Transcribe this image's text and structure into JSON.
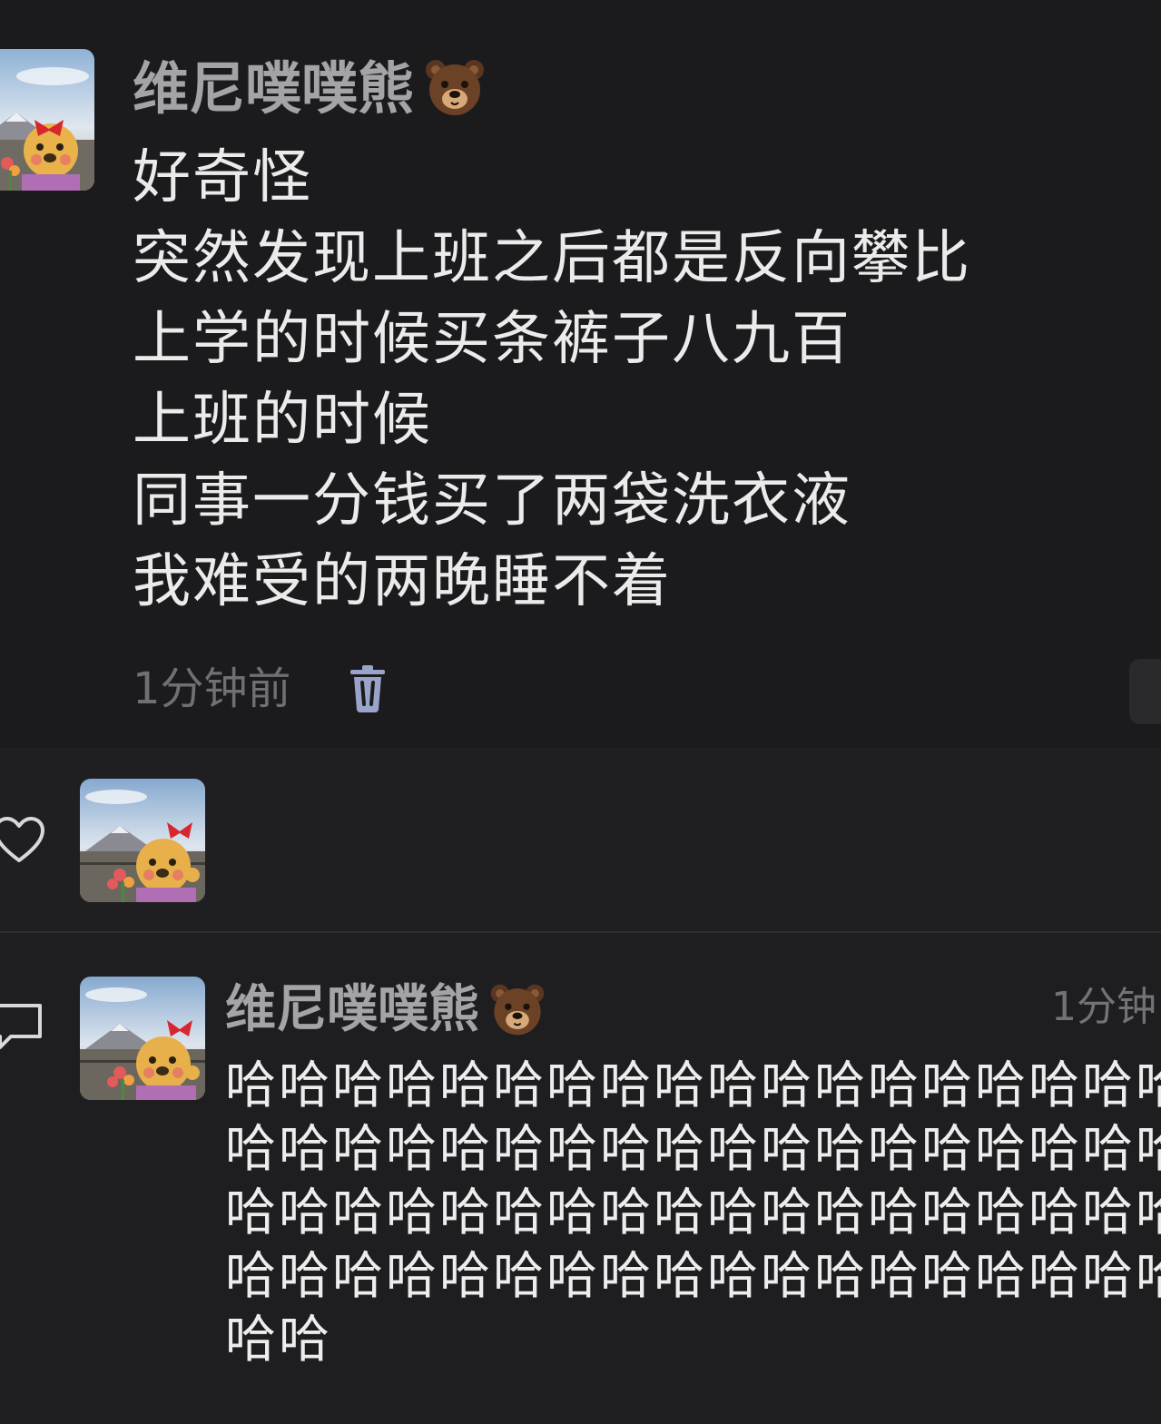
{
  "post": {
    "author": "维尼噗噗熊",
    "author_emoji": "bear-face-emoji",
    "lines": [
      "好奇怪",
      "突然发现上班之后都是反向攀比",
      "上学的时候买条裤子八九百",
      "上班的时候",
      "同事一分钱买了两袋洗衣液",
      "我难受的两晚睡不着"
    ],
    "timestamp": "1分钟前"
  },
  "comment": {
    "author": "维尼噗噗熊",
    "author_emoji": "bear-face-emoji",
    "time": "1分钟",
    "lines": [
      "哈哈哈哈哈哈哈哈哈哈哈哈哈哈哈哈哈哈",
      "哈哈哈哈哈哈哈哈哈哈哈哈哈哈哈哈哈哈",
      "哈哈哈哈哈哈哈哈哈哈哈哈哈哈哈哈哈哈",
      "哈哈哈哈哈哈哈哈哈哈哈哈哈哈哈哈哈哈",
      "哈哈"
    ]
  },
  "colors": {
    "background": "#1b1b1d",
    "author": "#a3a3a8",
    "body_text": "#ebebec",
    "muted": "#6f6f74",
    "trash_icon": "#9aa4c8"
  }
}
